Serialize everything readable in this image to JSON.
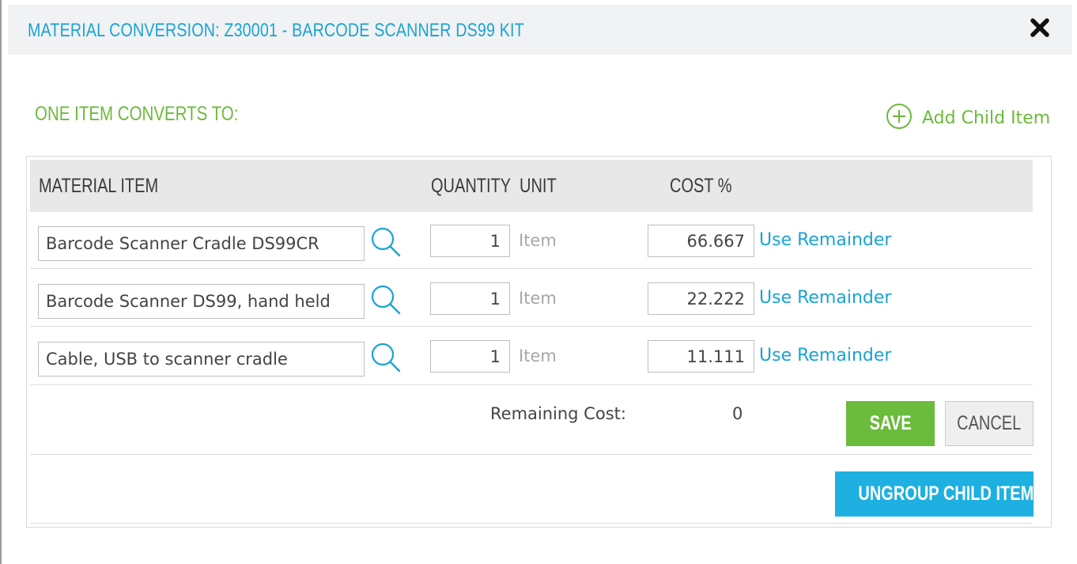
{
  "modal": {
    "title": "MATERIAL CONVERSION: Z30001 - BARCODE SCANNER DS99 KIT",
    "close_icon": "close-x-icon"
  },
  "section": {
    "title": "ONE ITEM CONVERTS TO:",
    "add_child_label": "Add Child Item",
    "add_child_icon": "plus-circle-icon"
  },
  "table": {
    "headers": {
      "material_item": "MATERIAL ITEM",
      "quantity": "QUANTITY",
      "unit": "UNIT",
      "cost_pct": "COST %"
    },
    "rows": [
      {
        "item": "Barcode Scanner Cradle DS99CR",
        "quantity": "1",
        "unit": "Item",
        "cost": "66.667",
        "use_remainder": "Use Remainder"
      },
      {
        "item": "Barcode Scanner DS99, hand held",
        "quantity": "1",
        "unit": "Item",
        "cost": "22.222",
        "use_remainder": "Use Remainder"
      },
      {
        "item": "Cable, USB to scanner cradle",
        "quantity": "1",
        "unit": "Item",
        "cost": "11.111",
        "use_remainder": "Use Remainder"
      }
    ]
  },
  "footer": {
    "remaining_label": "Remaining Cost:",
    "remaining_value": "0",
    "save_label": "SAVE",
    "cancel_label": "CANCEL",
    "ungroup_label": "UNGROUP CHILD ITEMS"
  },
  "colors": {
    "title_blue": "#1aa3d4",
    "accent_green": "#6cb93b",
    "link_blue": "#1aa3d4",
    "save_green": "#6bbb3c",
    "ungroup_blue": "#1eb0e0"
  }
}
